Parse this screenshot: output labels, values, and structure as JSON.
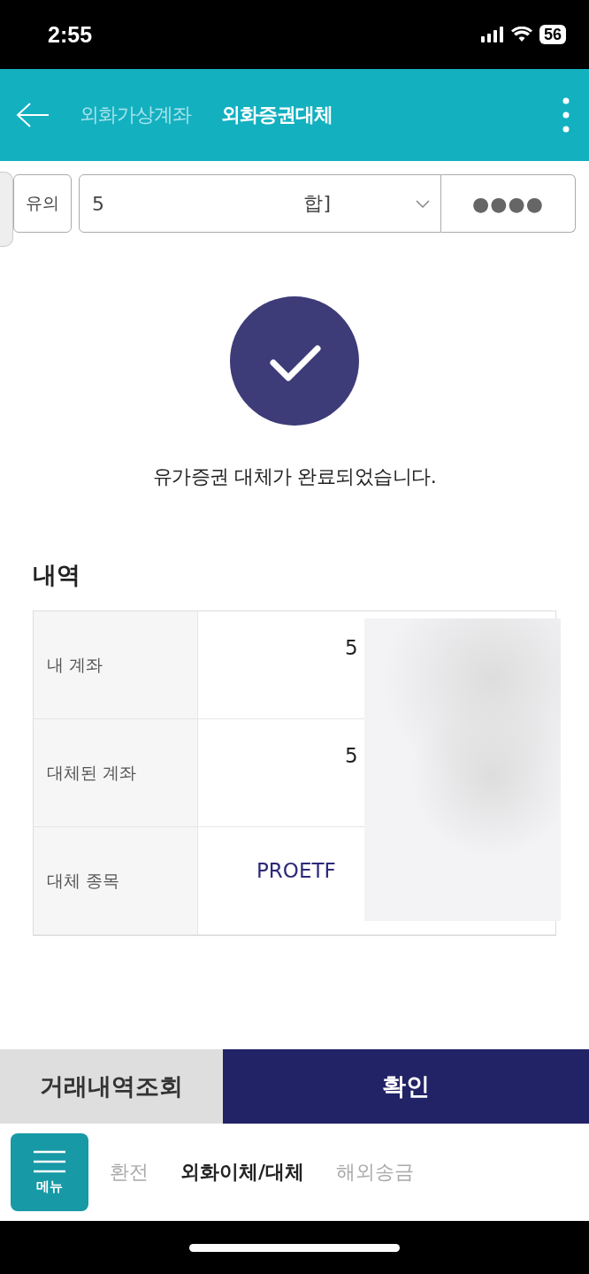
{
  "status_bar": {
    "time": "2:55",
    "battery": "56"
  },
  "header": {
    "tabs": [
      {
        "label": "외화가상계좌",
        "selected": false
      },
      {
        "label": "외화증권대체",
        "selected": true
      }
    ]
  },
  "account_bar": {
    "notice_button": "유의",
    "account_start": "5",
    "account_end": "합]",
    "password": "●●●●"
  },
  "result": {
    "message": "유가증권 대체가 완료되었습니다."
  },
  "details": {
    "title": "내역",
    "rows": [
      {
        "label": "내 계좌",
        "value": "5",
        "kind": "account"
      },
      {
        "label": "대체된 계좌",
        "value": "5",
        "kind": "account"
      },
      {
        "label": "대체 종목",
        "value": "PROETF",
        "kind": "security"
      }
    ]
  },
  "actions": [
    {
      "label": "거래내역조회",
      "kind": "secondary"
    },
    {
      "label": "확인",
      "kind": "primary"
    }
  ],
  "bottom_nav": {
    "menu_label": "메뉴",
    "items": [
      {
        "label": "환전",
        "selected": false
      },
      {
        "label": "외화이체/대체",
        "selected": true
      },
      {
        "label": "해외송금",
        "selected": false
      }
    ]
  }
}
